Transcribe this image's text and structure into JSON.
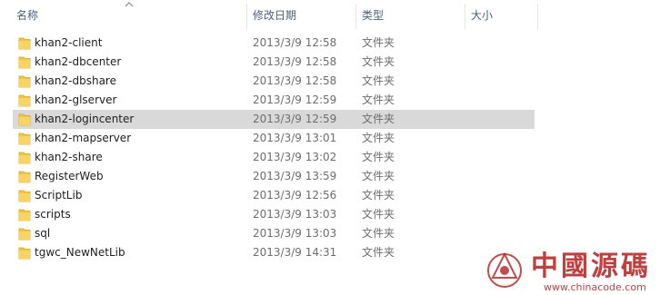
{
  "columns": {
    "name": "名称",
    "date": "修改日期",
    "type": "类型",
    "size": "大小"
  },
  "files": [
    {
      "name": "khan2-client",
      "date": "2013/3/9 12:58",
      "type": "文件夹",
      "selected": false
    },
    {
      "name": "khan2-dbcenter",
      "date": "2013/3/9 12:58",
      "type": "文件夹",
      "selected": false
    },
    {
      "name": "khan2-dbshare",
      "date": "2013/3/9 12:58",
      "type": "文件夹",
      "selected": false
    },
    {
      "name": "khan2-glserver",
      "date": "2013/3/9 12:59",
      "type": "文件夹",
      "selected": false
    },
    {
      "name": "khan2-logincenter",
      "date": "2013/3/9 12:59",
      "type": "文件夹",
      "selected": true
    },
    {
      "name": "khan2-mapserver",
      "date": "2013/3/9 13:01",
      "type": "文件夹",
      "selected": false
    },
    {
      "name": "khan2-share",
      "date": "2013/3/9 13:02",
      "type": "文件夹",
      "selected": false
    },
    {
      "name": "RegisterWeb",
      "date": "2013/3/9 13:59",
      "type": "文件夹",
      "selected": false
    },
    {
      "name": "ScriptLib",
      "date": "2013/3/9 12:56",
      "type": "文件夹",
      "selected": false
    },
    {
      "name": "scripts",
      "date": "2013/3/9 13:03",
      "type": "文件夹",
      "selected": false
    },
    {
      "name": "sql",
      "date": "2013/3/9 13:03",
      "type": "文件夹",
      "selected": false
    },
    {
      "name": "tgwc_NewNetLib",
      "date": "2013/3/9 14:31",
      "type": "文件夹",
      "selected": false
    }
  ],
  "watermark": {
    "text": "中國源碼",
    "url": "www.chinacode.com"
  },
  "colors": {
    "folder": "#f4c53d",
    "selection": "#d9d9d9",
    "header_text": "#4c607a",
    "watermark": "#b51f1f"
  }
}
